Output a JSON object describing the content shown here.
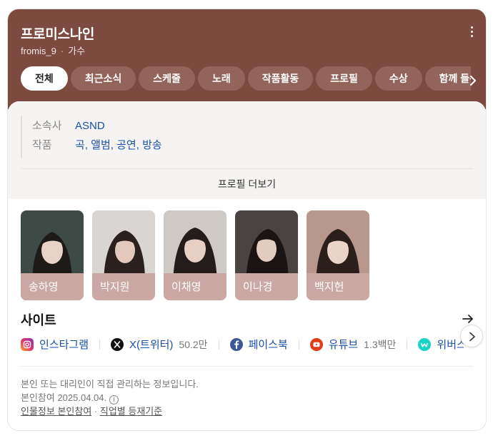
{
  "header": {
    "title": "프로미스나인",
    "subtitle_name": "fromis_9",
    "subtitle_role": "가수",
    "tabs": [
      {
        "label": "전체",
        "active": true
      },
      {
        "label": "최근소식"
      },
      {
        "label": "스케줄"
      },
      {
        "label": "노래"
      },
      {
        "label": "작품활동"
      },
      {
        "label": "프로필"
      },
      {
        "label": "수상"
      },
      {
        "label": "함께 들은 아티스트"
      }
    ]
  },
  "info": {
    "agency_label": "소속사",
    "agency_value": "ASND",
    "works_label": "작품",
    "works": [
      "곡",
      "앨범",
      "공연",
      "방송"
    ],
    "profile_more": "프로필 더보기"
  },
  "members": [
    {
      "name": "송하영",
      "bg": "#3d4a45"
    },
    {
      "name": "박지원",
      "bg": "#2b2624"
    },
    {
      "name": "이채영",
      "bg": "#3a2f2c"
    },
    {
      "name": "이나경",
      "bg": "#2a2323"
    },
    {
      "name": "백지헌",
      "bg": "#6b5048"
    }
  ],
  "sites": {
    "title": "사이트",
    "items": [
      {
        "label": "인스타그램",
        "count": "",
        "icon": "instagram-icon",
        "color": "#d6249f"
      },
      {
        "label": "X(트위터)",
        "count": "50.2만",
        "icon": "x-icon",
        "color": "#111111"
      },
      {
        "label": "페이스북",
        "count": "",
        "icon": "facebook-icon",
        "color": "#3b5998"
      },
      {
        "label": "유튜브",
        "count": "1.3백만",
        "icon": "youtube-icon",
        "color": "#e33b16"
      },
      {
        "label": "위버스",
        "count": "",
        "icon": "weverse-icon",
        "color": "#19d3c5"
      }
    ]
  },
  "footer": {
    "line1": "본인 또는 대리인이 직접 관리하는 정보입니다.",
    "line2": "본인참여 2025.04.04.",
    "link1": "인물정보 본인참여",
    "link_sep": "·",
    "link2": "직업별 등재기준"
  },
  "colors": {
    "header_bg": "#7c4a3f",
    "link": "#1a4fa8",
    "name_strip": "#cba8a4"
  }
}
